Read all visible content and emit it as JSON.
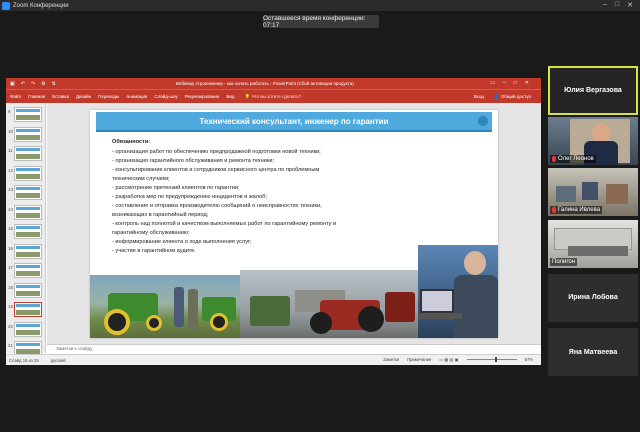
{
  "app": {
    "title": "Zoom Конференции"
  },
  "timer": "Оставшееся время конференции: 07:17",
  "ppt": {
    "doc_title": "Вебинар Агроинженер - как начать работать - PowerPoint (Сбой активации продукта)",
    "tabs": [
      "Файл",
      "Главная",
      "Вставка",
      "Дизайн",
      "Переходы",
      "Анимация",
      "Слайд-шоу",
      "Рецензирование",
      "Вид"
    ],
    "search": "Что вы хотите сделать?",
    "sign_in": "Вход",
    "share": "Общий доступ",
    "thumb_numbers": [
      "9",
      "10",
      "11",
      "12",
      "13",
      "14",
      "15",
      "16",
      "17",
      "18",
      "19",
      "20",
      "21"
    ],
    "active_thumb": "19",
    "notes_placeholder": "Заметки к слайду",
    "status": {
      "slide": "Слайд 19 из 28",
      "lang": "русский",
      "notes_btn": "Заметки",
      "comments_btn": "Примечания",
      "zoom": "67%"
    }
  },
  "slide": {
    "title": "Технический консультант, инженер по гарантии",
    "heading": "Обязанности:",
    "lines": [
      "- организация работ по обеспечению предпродажной подготовки новой техники;",
      "- организация гарантийного обслуживания и ремонта техники;",
      "- консультирование клиентов и сотрудников сервисного центра по проблемным",
      "техническим случаям;",
      "- рассмотрение претензий клиентов по гарантии;",
      "- разработка мер по предупреждению инцидентов и жалоб;",
      "- составление и отправка производителю сообщений о неисправностях техники,",
      "возникающих в гарантийный период;",
      "- контроль над полнотой и качеством выполняемых работ по гарантийному ремонту и",
      "гарантийному обслуживанию;",
      "- информирование клиента о ходе выполнения услуг;",
      "- участие в гарантийном аудите."
    ]
  },
  "participants": [
    {
      "name": "Юлия Вергазова",
      "video": false,
      "active_speaker": true
    },
    {
      "name": "Олег Леонов",
      "video": true,
      "muted": true
    },
    {
      "name": "Галина Ивлева",
      "video": true,
      "muted": true
    },
    {
      "name": "Полигон",
      "video": true,
      "muted": false
    },
    {
      "name": "Ирина Лобова",
      "video": false
    },
    {
      "name": "Яна Матвеева",
      "video": false
    }
  ],
  "colors": {
    "ppt_red": "#c0392b",
    "slide_blue": "#4fa9dc",
    "active_border": "#d7e23a"
  }
}
